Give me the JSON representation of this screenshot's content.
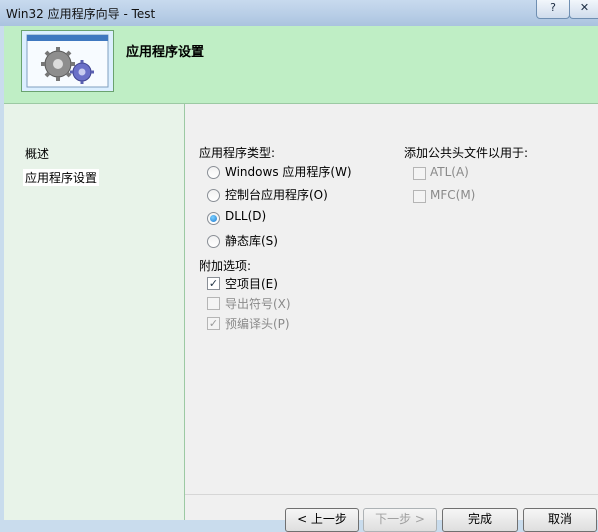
{
  "window": {
    "title": "Win32 应用程序向导 - Test",
    "help": "?",
    "close": "✕"
  },
  "header": {
    "title": "应用程序设置"
  },
  "nav": {
    "items": [
      {
        "label": "概述"
      },
      {
        "label": "应用程序设置"
      }
    ]
  },
  "app_type": {
    "label": "应用程序类型:",
    "options": [
      {
        "label": "Windows 应用程序(W)",
        "checked": false
      },
      {
        "label": "控制台应用程序(O)",
        "checked": false
      },
      {
        "label": "DLL(D)",
        "checked": true
      },
      {
        "label": "静态库(S)",
        "checked": false
      }
    ]
  },
  "extra_options": {
    "label": "附加选项:",
    "items": [
      {
        "label": "空项目(E)",
        "checked": true,
        "enabled": true
      },
      {
        "label": "导出符号(X)",
        "checked": false,
        "enabled": false
      },
      {
        "label": "预编译头(P)",
        "checked": true,
        "enabled": false
      }
    ]
  },
  "headers": {
    "label": "添加公共头文件以用于:",
    "items": [
      {
        "label": "ATL(A)",
        "checked": false,
        "enabled": false
      },
      {
        "label": "MFC(M)",
        "checked": false,
        "enabled": false
      }
    ]
  },
  "buttons": {
    "prev": "< 上一步",
    "next": "下一步 >",
    "finish": "完成",
    "cancel": "取消"
  }
}
